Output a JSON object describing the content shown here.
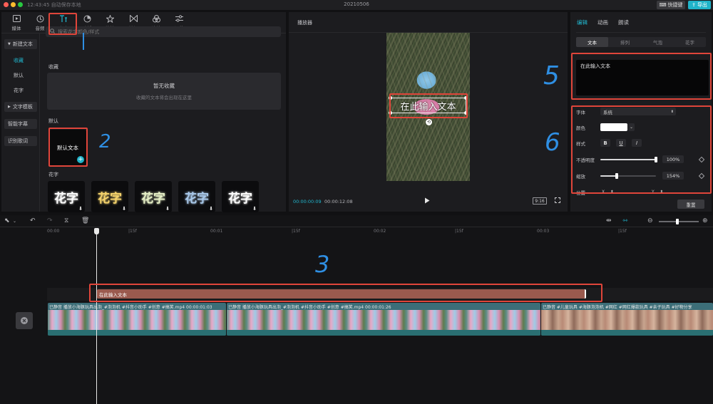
{
  "titlebar": {
    "status": "12:43:45 自动保存本地",
    "title": "20210506",
    "shortcut_label": "快捷键",
    "export_label": "导出"
  },
  "toolbar": {
    "tabs": [
      {
        "label": "媒体",
        "icon": "media-icon"
      },
      {
        "label": "音频",
        "icon": "audio-icon"
      },
      {
        "label": "文本",
        "icon": "text-icon"
      },
      {
        "label": "贴纸",
        "icon": "sticker-icon"
      },
      {
        "label": "特效",
        "icon": "effects-icon"
      },
      {
        "label": "转场",
        "icon": "transition-icon"
      },
      {
        "label": "滤镜",
        "icon": "filter-icon"
      },
      {
        "label": "调节",
        "icon": "adjust-icon"
      }
    ],
    "active_tab": "文本"
  },
  "categories": {
    "new_text": "新建文本",
    "favorites": "收藏",
    "default": "默认",
    "huazi": "花字",
    "text_template": "文字模板",
    "smart_subtitle": "智能字幕",
    "lyrics": "识别歌词"
  },
  "search": {
    "placeholder": "搜索花字颜色/样式"
  },
  "favorites_section": {
    "label": "收藏",
    "empty_title": "暂无收藏",
    "empty_subtitle": "收藏的文本将会出现在这里"
  },
  "default_section": {
    "label": "默认",
    "card_label": "默认文本"
  },
  "huazi_section": {
    "label": "花字",
    "card_text": "花字",
    "card_colors": [
      "#ffffff",
      "#f5d36b",
      "#e6f0c6",
      "#a8c8ea",
      "#ffffff"
    ]
  },
  "player": {
    "title": "播放器",
    "overlay_text": "在此输入文本",
    "time_current": "00:00:00:09",
    "time_total": "00:00:12:08",
    "ratio": "9:16"
  },
  "right_panel": {
    "tabs": [
      "编辑",
      "动画",
      "朗读"
    ],
    "active_tab": "编辑",
    "segments": [
      "文本",
      "排列",
      "气泡",
      "花字"
    ],
    "active_segment": "文本",
    "text_value": "在此输入文本",
    "font_label": "字体",
    "font_value": "系统",
    "color_label": "颜色",
    "style_label": "样式",
    "style_buttons": [
      "B",
      "U",
      "I"
    ],
    "opacity_label": "不透明度",
    "opacity_value": "100%",
    "opacity_fraction": 1.0,
    "scale_label": "缩放",
    "scale_value": "154%",
    "scale_fraction": 0.3,
    "position_label": "位置",
    "reset_label": "重置"
  },
  "timeline": {
    "ruler_labels": [
      "00:00",
      "|15f",
      "00:01",
      "|15f",
      "00:02",
      "|15f",
      "00:03",
      "|15f"
    ],
    "text_clip_label": "在此输入文本",
    "video_clips": [
      {
        "label": "已静音    播放小海豚玩具出泡_#泡泡机 #抖音小助手 #创意 #搞笑.mp4    00:00:01:03"
      },
      {
        "label": "已静音    播放小海豚玩具出泡_#泡泡机 #抖音小助手 #创意 #搞笑.mp4    00:00:01:26"
      },
      {
        "label": "已静音    #儿童玩具 #海豚泡泡机 #网红 #网红爆款玩具 #亲子玩具 #好物分享"
      }
    ]
  },
  "annotations": [
    "2",
    "3",
    "5",
    "6"
  ],
  "colors": {
    "accent": "#21b8d0",
    "annotation_box": "#e0453a",
    "annotation_number": "#2f8fe3",
    "text_clip": "#9a5a4e",
    "video_clip_bottom": "#2a6f72"
  }
}
